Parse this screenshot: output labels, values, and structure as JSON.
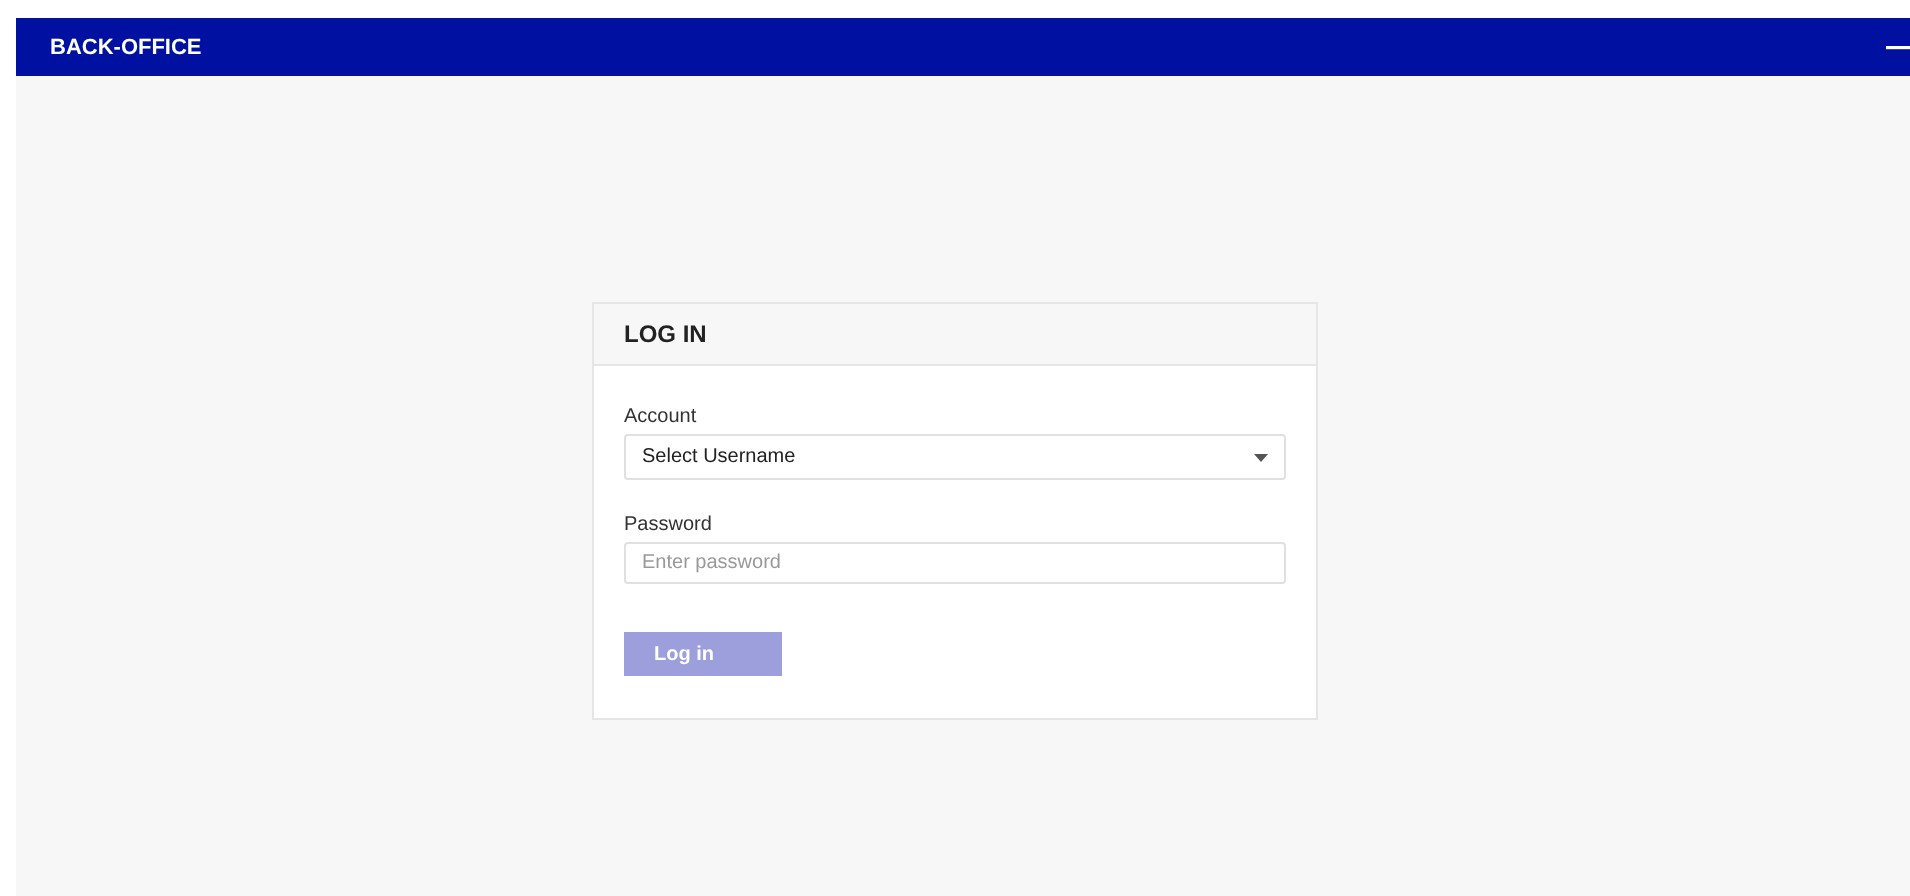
{
  "app_bar": {
    "title": "BACK-OFFICE"
  },
  "login_card": {
    "title": "LOG IN",
    "account": {
      "label": "Account",
      "value": "Select Username"
    },
    "password": {
      "label": "Password",
      "placeholder": "Enter password"
    },
    "submit": {
      "label": "Log in",
      "disabled": true
    }
  }
}
